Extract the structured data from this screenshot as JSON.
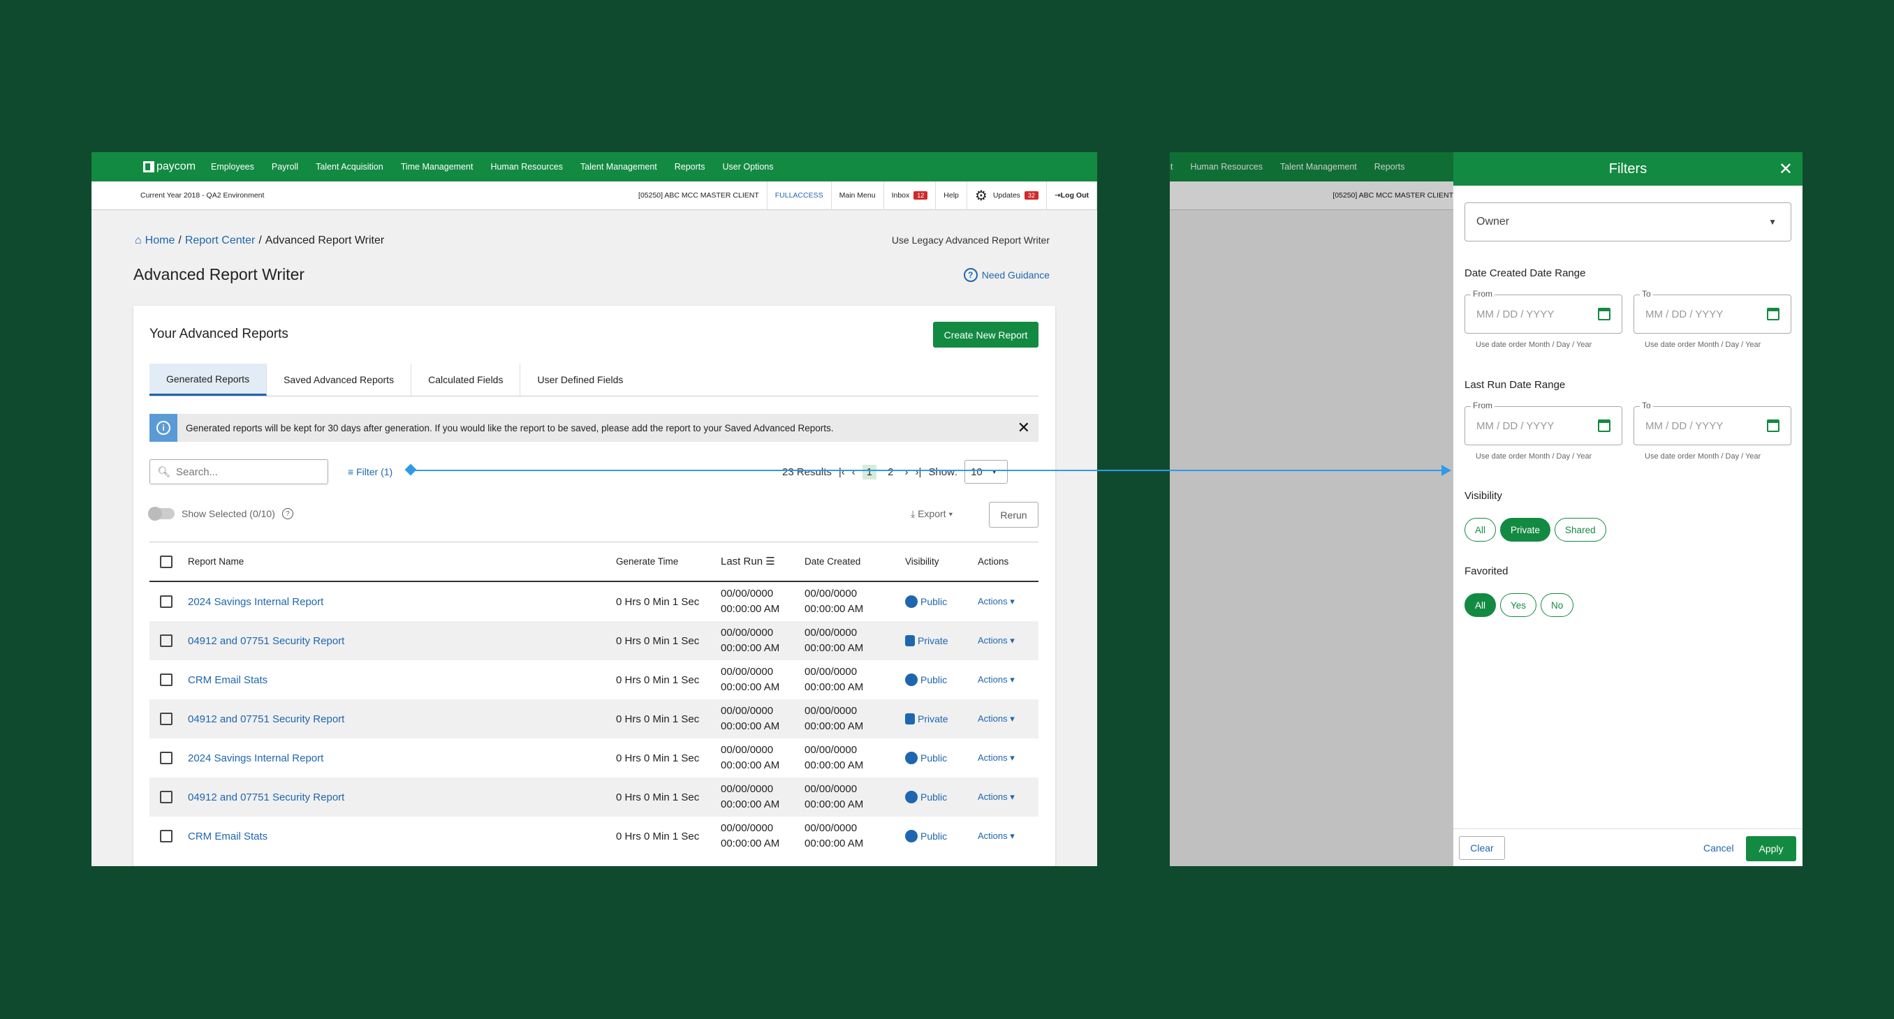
{
  "nav": {
    "logo": "paycom",
    "items": [
      "Employees",
      "Payroll",
      "Talent Acquisition",
      "Time Management",
      "Human Resources",
      "Talent Management",
      "Reports",
      "User Options"
    ]
  },
  "subbar": {
    "env": "Current Year 2018 - QA2 Environment",
    "client": "[05250] ABC MCC MASTER CLIENT",
    "access": "FULLACCESS",
    "main_menu": "Main Menu",
    "inbox": "Inbox",
    "inbox_count": "12",
    "help": "Help",
    "updates": "Updates",
    "updates_count": "32",
    "logout": "Log Out"
  },
  "crumbs": {
    "home": "Home",
    "report_center": "Report Center",
    "current": "Advanced Report Writer"
  },
  "legacy": "Use Legacy Advanced Report Writer",
  "page_title": "Advanced Report Writer",
  "guidance": "Need Guidance",
  "card": {
    "title": "Your Advanced Reports",
    "create": "Create New Report"
  },
  "tabs": [
    "Generated Reports",
    "Saved Advanced Reports",
    "Calculated Fields",
    "User Defined Fields"
  ],
  "banner": "Generated reports will be kept for 30 days after generation. If you would like the report to be saved, please add the report to your Saved Advanced Reports.",
  "search_placeholder": "Search...",
  "filter": "Filter (1)",
  "pager": {
    "results": "23 Results",
    "p1": "1",
    "p2": "2",
    "show": "Show:",
    "show_val": "10"
  },
  "show_selected": "Show Selected (0/10)",
  "export": "Export",
  "rerun": "Rerun",
  "headers": {
    "name": "Report Name",
    "gen": "Generate Time",
    "last": "Last Run",
    "date": "Date Created",
    "vis": "Visibility",
    "act": "Actions"
  },
  "rows": [
    {
      "name": "2024 Savings Internal Report",
      "gen": "0 Hrs 0 Min 1 Sec",
      "d": "00/00/0000",
      "t": "00:00:00 AM",
      "vis": "Public",
      "act": "Actions"
    },
    {
      "name": "04912 and 07751 Security Report",
      "gen": "0 Hrs 0 Min 1 Sec",
      "d": "00/00/0000",
      "t": "00:00:00 AM",
      "vis": "Private",
      "act": "Actions"
    },
    {
      "name": "CRM Email Stats",
      "gen": "0 Hrs 0 Min 1 Sec",
      "d": "00/00/0000",
      "t": "00:00:00 AM",
      "vis": "Public",
      "act": "Actions"
    },
    {
      "name": "04912 and 07751 Security Report",
      "gen": "0 Hrs 0 Min 1 Sec",
      "d": "00/00/0000",
      "t": "00:00:00 AM",
      "vis": "Private",
      "act": "Actions"
    },
    {
      "name": "2024 Savings Internal Report",
      "gen": "0 Hrs 0 Min 1 Sec",
      "d": "00/00/0000",
      "t": "00:00:00 AM",
      "vis": "Public",
      "act": "Actions"
    },
    {
      "name": "04912 and 07751 Security Report",
      "gen": "0 Hrs 0 Min 1 Sec",
      "d": "00/00/0000",
      "t": "00:00:00 AM",
      "vis": "Public",
      "act": "Actions"
    },
    {
      "name": "CRM Email Stats",
      "gen": "0 Hrs 0 Min 1 Sec",
      "d": "00/00/0000",
      "t": "00:00:00 AM",
      "vis": "Public",
      "act": "Actions"
    }
  ],
  "filters": {
    "title": "Filters",
    "owner": "Owner",
    "created": "Date Created Date Range",
    "lastrun": "Last Run Date Range",
    "from": "From",
    "to": "To",
    "placeholder": "MM / DD / YYYY",
    "hint": "Use date order Month / Day / Year",
    "visibility": "Visibility",
    "vis_opts": [
      "All",
      "Private",
      "Shared"
    ],
    "favorited": "Favorited",
    "fav_opts": [
      "All",
      "Yes",
      "No"
    ],
    "clear": "Clear",
    "cancel": "Cancel",
    "apply": "Apply"
  },
  "colors": {
    "green": "#138a41",
    "link": "#1f66b0",
    "arrow": "#2f9be8"
  }
}
